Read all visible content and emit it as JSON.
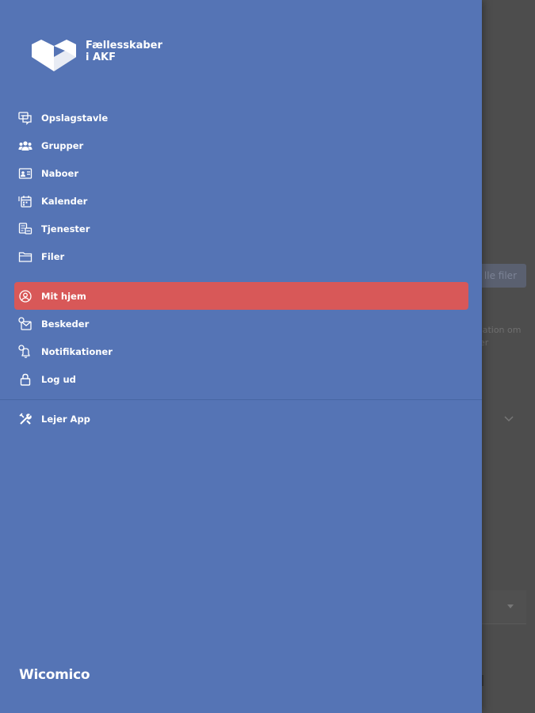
{
  "brand": {
    "line1": "Fællesskaber",
    "line2": "i AKF"
  },
  "nav": {
    "group1": [
      {
        "label": "Opslagstavle",
        "icon": "message-board-icon"
      },
      {
        "label": "Grupper",
        "icon": "groups-icon"
      },
      {
        "label": "Naboer",
        "icon": "neighbors-icon"
      },
      {
        "label": "Kalender",
        "icon": "calendar-icon"
      },
      {
        "label": "Tjenester",
        "icon": "services-icon"
      },
      {
        "label": "Filer",
        "icon": "folder-icon"
      }
    ],
    "group2": [
      {
        "label": "Mit hjem",
        "icon": "user-circle-icon",
        "active": true
      },
      {
        "label": "Beskeder",
        "icon": "messages-icon"
      },
      {
        "label": "Notifikationer",
        "icon": "notifications-icon"
      },
      {
        "label": "Log ud",
        "icon": "lock-icon"
      }
    ],
    "group3": [
      {
        "label": "Lejer App",
        "icon": "tools-icon"
      }
    ]
  },
  "footer": {
    "brand": "Wicomico"
  },
  "background": {
    "button_fragment": "lle filer",
    "text_fragment_1": "mation om",
    "text_fragment_2": "per"
  },
  "colors": {
    "drawer": "#5574b5",
    "active": "#d85858",
    "overlay": "#4d4d4d"
  }
}
